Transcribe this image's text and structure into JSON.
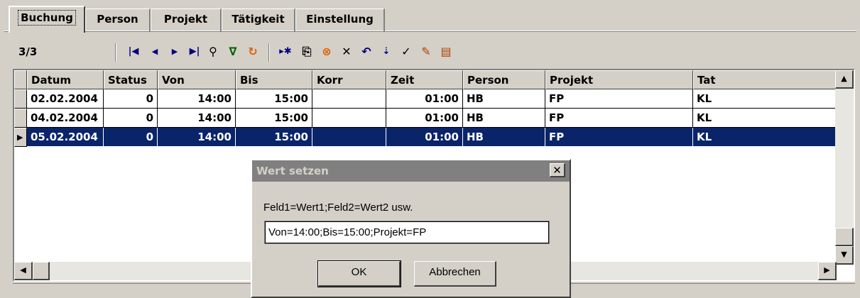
{
  "tabs": [
    "Buchung",
    "Person",
    "Projekt",
    "Tätigkeit",
    "Einstellung"
  ],
  "toolbar": {
    "counter": "3/3",
    "nav_first": "⏮",
    "nav_prev": "◀",
    "nav_next": "▶",
    "nav_last": "⏭",
    "icons": [
      "first-icon",
      "prev-icon",
      "next-icon",
      "last-icon",
      "find-icon",
      "filter-icon",
      "refresh-icon",
      "insert-icon",
      "copy-icon",
      "cancel-icon",
      "delete-icon",
      "undo-icon",
      "move-icon",
      "post-icon",
      "edit-icon",
      "save-icon"
    ]
  },
  "grid": {
    "headers": [
      "Datum",
      "Status",
      "Von",
      "Bis",
      "Korr",
      "Zeit",
      "Person",
      "Projekt",
      "Tat"
    ],
    "rows": [
      [
        "02.02.2004",
        "0",
        "14:00",
        "15:00",
        "",
        "01:00",
        "HB",
        "FP",
        "KL"
      ],
      [
        "04.02.2004",
        "0",
        "14:00",
        "15:00",
        "",
        "01:00",
        "HB",
        "FP",
        "KL"
      ],
      [
        "05.02.2004",
        "0",
        "14:00",
        "15:00",
        "",
        "01:00",
        "HB",
        "FP",
        "KL"
      ]
    ]
  },
  "dialog": {
    "title": "Wert setzen",
    "close": "✕",
    "label": "Feld1=Wert1;Feld2=Wert2 usw.",
    "input_value": "Von=14:00;Bis=15:00;Projekt=FP",
    "ok": "OK",
    "cancel": "Abbrechen"
  },
  "colors": {
    "selection": "#0a246a",
    "face": "#d4d0c8"
  }
}
